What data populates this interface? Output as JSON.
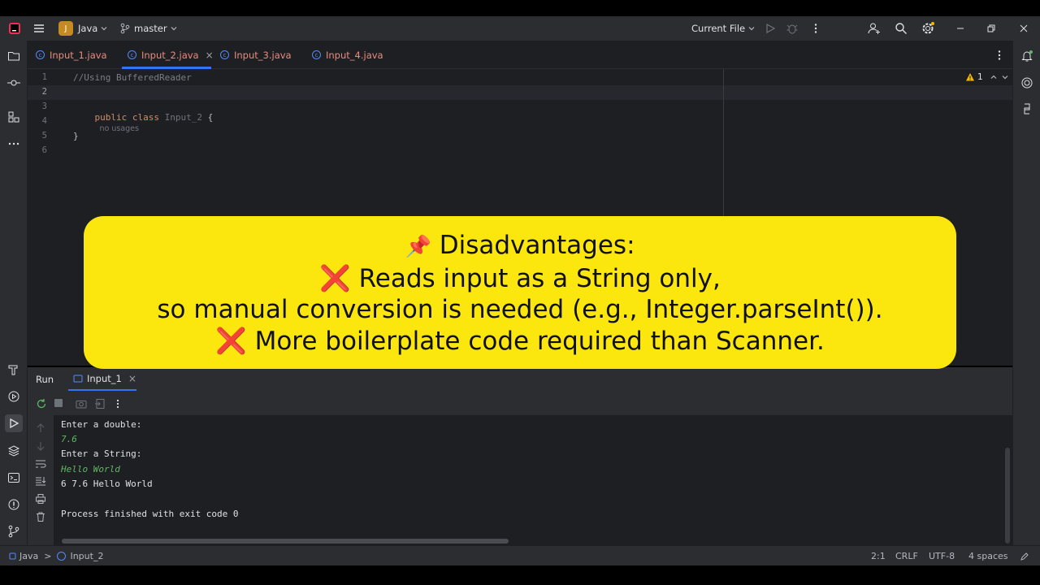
{
  "titlebar": {
    "project_initial": "J",
    "project_name": "Java",
    "branch": "master",
    "run_config": "Current File"
  },
  "tabs": [
    {
      "label": "Input_1.java",
      "active": false
    },
    {
      "label": "Input_2.java",
      "active": true,
      "close": "×"
    },
    {
      "label": "Input_3.java",
      "active": false
    },
    {
      "label": "Input_4.java",
      "active": false
    }
  ],
  "editor": {
    "line_numbers": [
      "1",
      "2",
      "3",
      "4",
      "5",
      "6"
    ],
    "comment": "//Using BufferedReader",
    "kw_public": "public",
    "kw_class": "class",
    "class_name": "Input_2",
    "open_brace": "{",
    "usages_hint": "no usages",
    "close_brace": "}",
    "warning_count": "1"
  },
  "banner": {
    "line1_icon": "📌",
    "line1": "Disadvantages:",
    "line2_icon": "❌",
    "line2": "Reads input as a String only,",
    "line3": "so manual conversion is needed (e.g., Integer.parseInt()).",
    "line4_icon": "❌",
    "line4": "More boilerplate code required than Scanner."
  },
  "run_panel": {
    "title": "Run",
    "tab_label": "Input_1",
    "tab_close": "×",
    "console": [
      {
        "text": "Enter a double:",
        "kind": "out"
      },
      {
        "text": "7.6",
        "kind": "in"
      },
      {
        "text": "Enter a String:",
        "kind": "out"
      },
      {
        "text": "Hello World",
        "kind": "in"
      },
      {
        "text": "6 7.6 Hello World",
        "kind": "out"
      },
      {
        "text": "",
        "kind": "out"
      },
      {
        "text": "Process finished with exit code 0",
        "kind": "out"
      }
    ]
  },
  "statusbar": {
    "project": "Java",
    "separator": ">",
    "file": "Input_2",
    "position": "2:1",
    "line_ending": "CRLF",
    "encoding": "UTF-8",
    "indent": "4 spaces"
  },
  "colors": {
    "accent": "#3574f0",
    "banner": "#fbe70e",
    "keyword": "#cf8e6d",
    "comment": "#7a7e85",
    "user_input": "#5fb865",
    "tab_text": "#e88c7d"
  }
}
